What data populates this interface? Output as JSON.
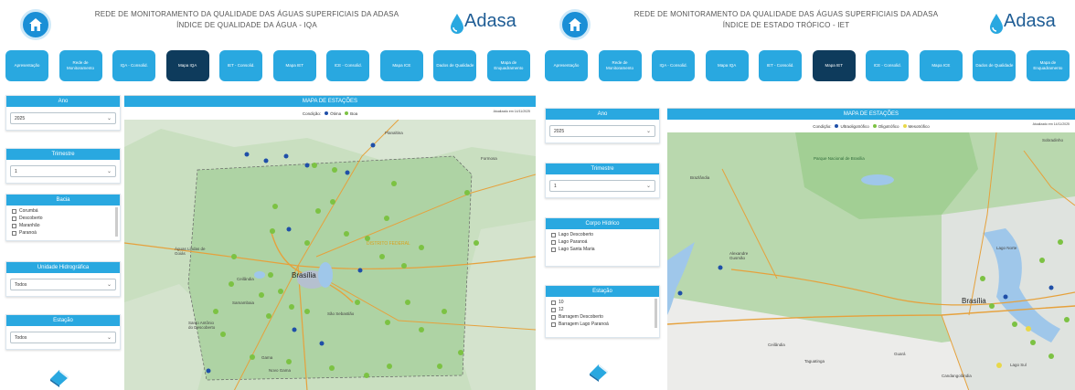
{
  "left": {
    "header": {
      "line1": "REDE DE MONITORAMENTO DA QUALIDADE DAS ÁGUAS SUPERFICIAIS DA ADASA",
      "line2": "ÍNDICE DE QUALIDADE DA ÁGUA - IQA"
    },
    "logo": {
      "text": "Adasa"
    },
    "nav": [
      {
        "label": "Apresentação",
        "active": false
      },
      {
        "label": "Rede de Monitoramento",
        "active": false
      },
      {
        "label": "IQA - Consolid.",
        "active": false
      },
      {
        "label": "Mapa IQA",
        "active": true
      },
      {
        "label": "IET - Consolid.",
        "active": false
      },
      {
        "label": "Mapa IET",
        "active": false
      },
      {
        "label": "ICE - Consolid.",
        "active": false
      },
      {
        "label": "Mapa ICE",
        "active": false
      },
      {
        "label": "Dados de Qualidade",
        "active": false
      },
      {
        "label": "Mapa de Enquadramento",
        "active": false
      }
    ],
    "filters": {
      "ano": {
        "title": "Ano",
        "value": "2025"
      },
      "trimestre": {
        "title": "Trimestre",
        "value": "1"
      },
      "bacia": {
        "title": "Bacia",
        "items": [
          "Corumbá",
          "Descoberto",
          "Maranhão",
          "Paranoá"
        ]
      },
      "unidade": {
        "title": "Unidade Hidrográfica",
        "value": "Todos"
      },
      "estacao": {
        "title": "Estação",
        "value": "Todos"
      }
    },
    "map": {
      "title": "MAPA DE ESTAÇÕES",
      "legend_label": "Condição:",
      "legend": [
        {
          "name": "Ótima",
          "color": "#1f4fa8"
        },
        {
          "name": "Boa",
          "color": "#7cc243"
        }
      ],
      "updated": "Atualizado em 14/11/2025",
      "labels": {
        "brasilia": "Brasília",
        "distrito": "DISTRITO FEDERAL",
        "aguas": "Águas Lindas de Goiás",
        "planaltina": "Planaltina",
        "formosa": "Formosa",
        "valparaiso": "Valparaíso de Goiás",
        "ceilandia": "Ceilândia",
        "samambaia": "Samambaia",
        "sao_sebastiao": "São Sebastião",
        "santo_antonio": "Santo Antônio do Descoberto",
        "gama": "Gama",
        "novo_gama": "Novo Gama"
      }
    }
  },
  "right": {
    "header": {
      "line1": "REDE DE MONITORAMENTO DA QUALIDADE DAS ÁGUAS SUPERFICIAIS DA ADASA",
      "line2": "ÍNDICE DE ESTADO TRÓFICO - IET"
    },
    "logo": {
      "text": "Adasa"
    },
    "nav": [
      {
        "label": "Apresentação",
        "active": false
      },
      {
        "label": "Rede de Monitoramento",
        "active": false
      },
      {
        "label": "IQA - Consolid.",
        "active": false
      },
      {
        "label": "Mapa IQA",
        "active": false
      },
      {
        "label": "IET - Consolid.",
        "active": false
      },
      {
        "label": "Mapa IET",
        "active": true
      },
      {
        "label": "ICE - Consolid.",
        "active": false
      },
      {
        "label": "Mapa ICE",
        "active": false
      },
      {
        "label": "Dados de Qualidade",
        "active": false
      },
      {
        "label": "Mapa de Enquadramento",
        "active": false
      }
    ],
    "filters": {
      "ano": {
        "title": "Ano",
        "value": "2025"
      },
      "trimestre": {
        "title": "Trimestre",
        "value": "1"
      },
      "corpo": {
        "title": "Corpo Hídrico",
        "items": [
          "Lago Descoberto",
          "Lago Paranoá",
          "Lago Santa Maria"
        ]
      },
      "estacao": {
        "title": "Estação",
        "items": [
          "10",
          "12",
          "Barragem Descoberto",
          "Barragem Lago Paranoá"
        ]
      }
    },
    "map": {
      "title": "MAPA DE ESTAÇÕES",
      "legend_label": "Condição:",
      "legend": [
        {
          "name": "Ultraoligotrófico",
          "color": "#1f4fa8"
        },
        {
          "name": "Oligotrófico",
          "color": "#7cc243"
        },
        {
          "name": "Mesotrófico",
          "color": "#e8d84a"
        }
      ],
      "updated": "Atualizado em 14/11/2025",
      "labels": {
        "brasilia": "Brasília",
        "parque": "Parque Nacional de Brasília",
        "brazlandia": "Brazlândia",
        "alexandre": "Alexandre Gusmão",
        "ceilandia": "Ceilândia",
        "taguatinga": "Taguatinga",
        "guara": "Guará",
        "sobradinho": "Sobradinho",
        "lago_norte": "Lago Norte",
        "lago_sul": "Lago Sul",
        "candangolandia": "Candangolândia"
      }
    }
  }
}
